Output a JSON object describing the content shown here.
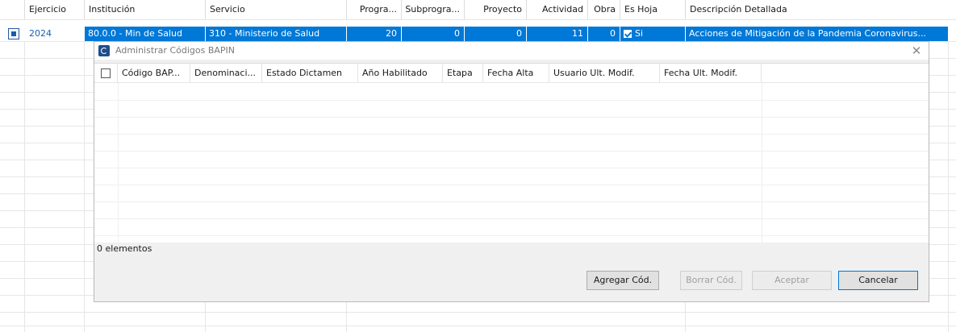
{
  "grid": {
    "columns": [
      "Ejercicio",
      "Institución",
      "Servicio",
      "Progra...",
      "Subprogra...",
      "Proyecto",
      "Actividad",
      "Obra",
      "Es Hoja",
      "Descripción Detallada"
    ],
    "row": {
      "ejercicio": "2024",
      "institucion": "80.0.0 - Min de Salud",
      "servicio": "310 - Ministerio de Salud",
      "programa": "20",
      "subprograma": "0",
      "proyecto": "0",
      "actividad": "11",
      "obra": "0",
      "es_hoja": "Si",
      "descripcion": "Acciones de Mitigación de la Pandemia Coronavirus..."
    }
  },
  "dialog": {
    "title": "Administrar Códigos BAPIN",
    "columns": [
      "Código BAP...",
      "Denominaci...",
      "Estado Dictamen",
      "Año Habilitado",
      "Etapa",
      "Fecha Alta",
      "Usuario Ult. Modif.",
      "Fecha Ult. Modif."
    ],
    "status": "0 elementos",
    "buttons": {
      "agregar": "Agregar Cód.",
      "borrar": "Borrar Cód.",
      "aceptar": "Aceptar",
      "cancelar": "Cancelar"
    }
  },
  "colors": {
    "selection": "#0078d7",
    "link": "#1a5fb4",
    "dialog_bg": "#f0f0f0"
  },
  "icons": [
    "row-selector-icon",
    "checkbox-checked-icon",
    "app-icon",
    "close-icon"
  ]
}
